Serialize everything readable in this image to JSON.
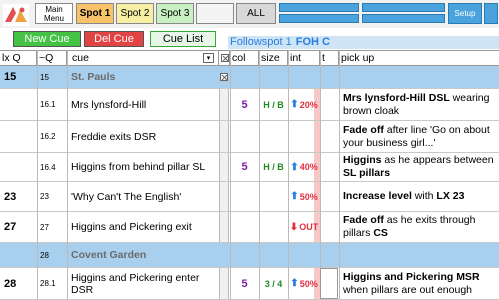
{
  "toolbar": {
    "main_menu": "Main Menu",
    "spot1": "Spot 1",
    "spot2": "Spot 2",
    "spot3": "Spot 3",
    "all": "ALL",
    "setup": "Setup"
  },
  "actions": {
    "new_cue": "New Cue",
    "del_cue": "Del Cue",
    "cue_list": "Cue List"
  },
  "followspot": {
    "label": "Followspot 1",
    "position": "FOH C"
  },
  "columns": {
    "lx": "lx Q",
    "q": "~Q",
    "cue": "cue",
    "col": "col",
    "size": "size",
    "int": "int",
    "t": "t",
    "pickup": "pick up"
  },
  "rows": [
    {
      "lx": "15",
      "q": "15",
      "cue": "St. Pauls",
      "scene": true
    },
    {
      "lx": "",
      "q": "16.1",
      "cue": "Mrs lynsford-Hill",
      "col": "5",
      "size": "H / B",
      "int": "20%",
      "dir": "up",
      "pick_bold": "Mrs lynsford-Hill DSL",
      "pick_rest": " wearing brown cloak"
    },
    {
      "lx": "",
      "q": "16.2",
      "cue": " Freddie exits DSR",
      "pick_bold": "Fade off",
      "pick_rest": " after line 'Go on about your business girl...'"
    },
    {
      "lx": "",
      "q": "16.4",
      "cue": "Higgins from behind pillar SL",
      "col": "5",
      "size": "H / B",
      "int": "40%",
      "dir": "up",
      "pick_bold": "Higgins",
      "pick_rest": " as he appears between ",
      "pick_bold2": "SL pillars"
    },
    {
      "lx": "23",
      "q": "23",
      "cue": " 'Why Can't The English'",
      "int": "50%",
      "dir": "up",
      "pick_bold": "Increase level",
      "pick_rest": " with ",
      "pick_bold2": "LX 23"
    },
    {
      "lx": "27",
      "q": "27",
      "cue": "Higgins and Pickering exit",
      "int": "OUT",
      "dir": "down",
      "pick_bold": "Fade off",
      "pick_rest": " as he exits through pillars ",
      "pick_bold2": "CS"
    },
    {
      "lx": "",
      "q": "28",
      "cue": "Covent Garden",
      "scene": true
    },
    {
      "lx": "28",
      "q": "28.1",
      "cue": "Higgins and Pickering enter DSR",
      "col": "5",
      "size": "3 / 4",
      "int": "50%",
      "dir": "up",
      "pick_bold": "Higgins and Pickering MSR",
      "pick_rest": " when pillars are out enough"
    }
  ]
}
